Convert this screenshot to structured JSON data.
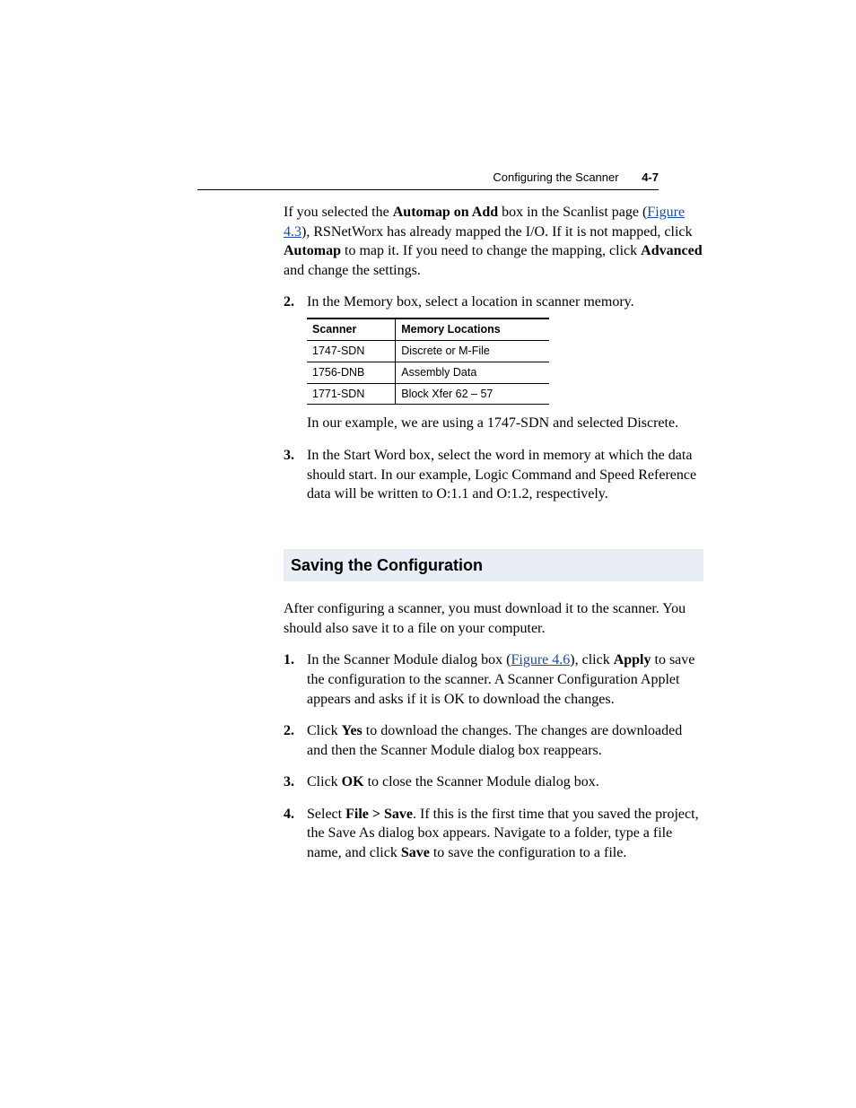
{
  "header": {
    "title": "Configuring the Scanner",
    "page_num": "4-7"
  },
  "intro": {
    "part1": "If you selected the ",
    "bold1": "Automap on Add",
    "part2": " box in the Scanlist page (",
    "link1": "Figure 4.3",
    "part3": "), RSNetWorx has already mapped the I/O. If it is not mapped, click ",
    "bold2": "Automap",
    "part4": " to map it. If you need to change the mapping, click ",
    "bold3": "Advanced",
    "part5": " and change the settings."
  },
  "step2": {
    "num": "2.",
    "text": "In the Memory box, select a location in scanner memory."
  },
  "table": {
    "h1": "Scanner",
    "h2": "Memory Locations",
    "rows": [
      {
        "c1": "1747-SDN",
        "c2": "Discrete or M-File"
      },
      {
        "c1": "1756-DNB",
        "c2": "Assembly Data"
      },
      {
        "c1": "1771-SDN",
        "c2": "Block Xfer 62 – 57"
      }
    ],
    "note": "In our example, we are using a 1747-SDN and selected Discrete."
  },
  "step3": {
    "num": "3.",
    "text": "In the Start Word box, select the word in memory at which the data should start. In our example, Logic Command and Speed Reference data will be written to O:1.1 and O:1.2, respectively."
  },
  "section": {
    "heading": "Saving the Configuration",
    "lead": "After configuring a scanner, you must download it to the scanner. You should also save it to a file on your computer.",
    "s1": {
      "num": "1.",
      "p1": "In the Scanner Module dialog box (",
      "link": "Figure 4.6",
      "p2": "), click ",
      "bold": "Apply",
      "p3": " to save the configuration to the scanner. A Scanner Configuration Applet appears and asks if it is OK to download the changes."
    },
    "s2": {
      "num": "2.",
      "p1": "Click ",
      "bold": "Yes",
      "p2": " to download the changes. The changes are downloaded and then the Scanner Module dialog box reappears."
    },
    "s3": {
      "num": "3.",
      "p1": "Click ",
      "bold": "OK",
      "p2": " to close the Scanner Module dialog box."
    },
    "s4": {
      "num": "4.",
      "p1": "Select ",
      "bold1": "File > Save",
      "p2": ". If this is the first time that you saved the project, the Save As dialog box appears. Navigate to a folder, type a file name, and click ",
      "bold2": "Save",
      "p3": " to save the configuration to a file."
    }
  }
}
